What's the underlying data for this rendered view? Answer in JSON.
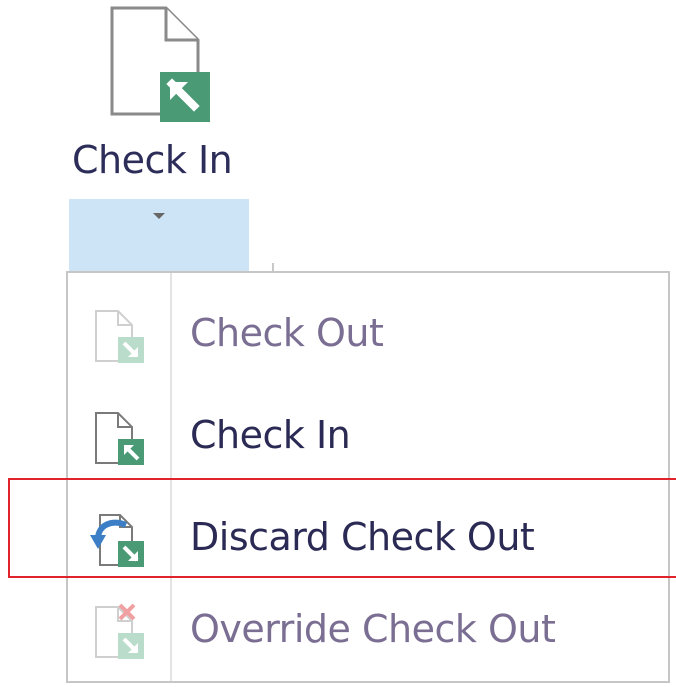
{
  "ribbon": {
    "check_in_label": "Check In",
    "dropdown_icon": "caret-down-icon",
    "main_icon": "check-in-document-icon"
  },
  "menu": {
    "items": [
      {
        "label": "Check Out",
        "icon": "check-out-icon",
        "enabled": false
      },
      {
        "label": "Check In",
        "icon": "check-in-icon",
        "enabled": true
      },
      {
        "label": "Discard Check Out",
        "icon": "discard-check-out-icon",
        "enabled": true,
        "highlighted": true
      },
      {
        "label": "Override Check Out",
        "icon": "override-check-out-icon",
        "enabled": false
      }
    ]
  },
  "colors": {
    "accent_green": "#4a9a76",
    "dropdown_highlight": "#cde4f7",
    "highlight_border": "#e0232b",
    "arrow_blue": "#3d7fc6",
    "override_red": "#e25555"
  }
}
